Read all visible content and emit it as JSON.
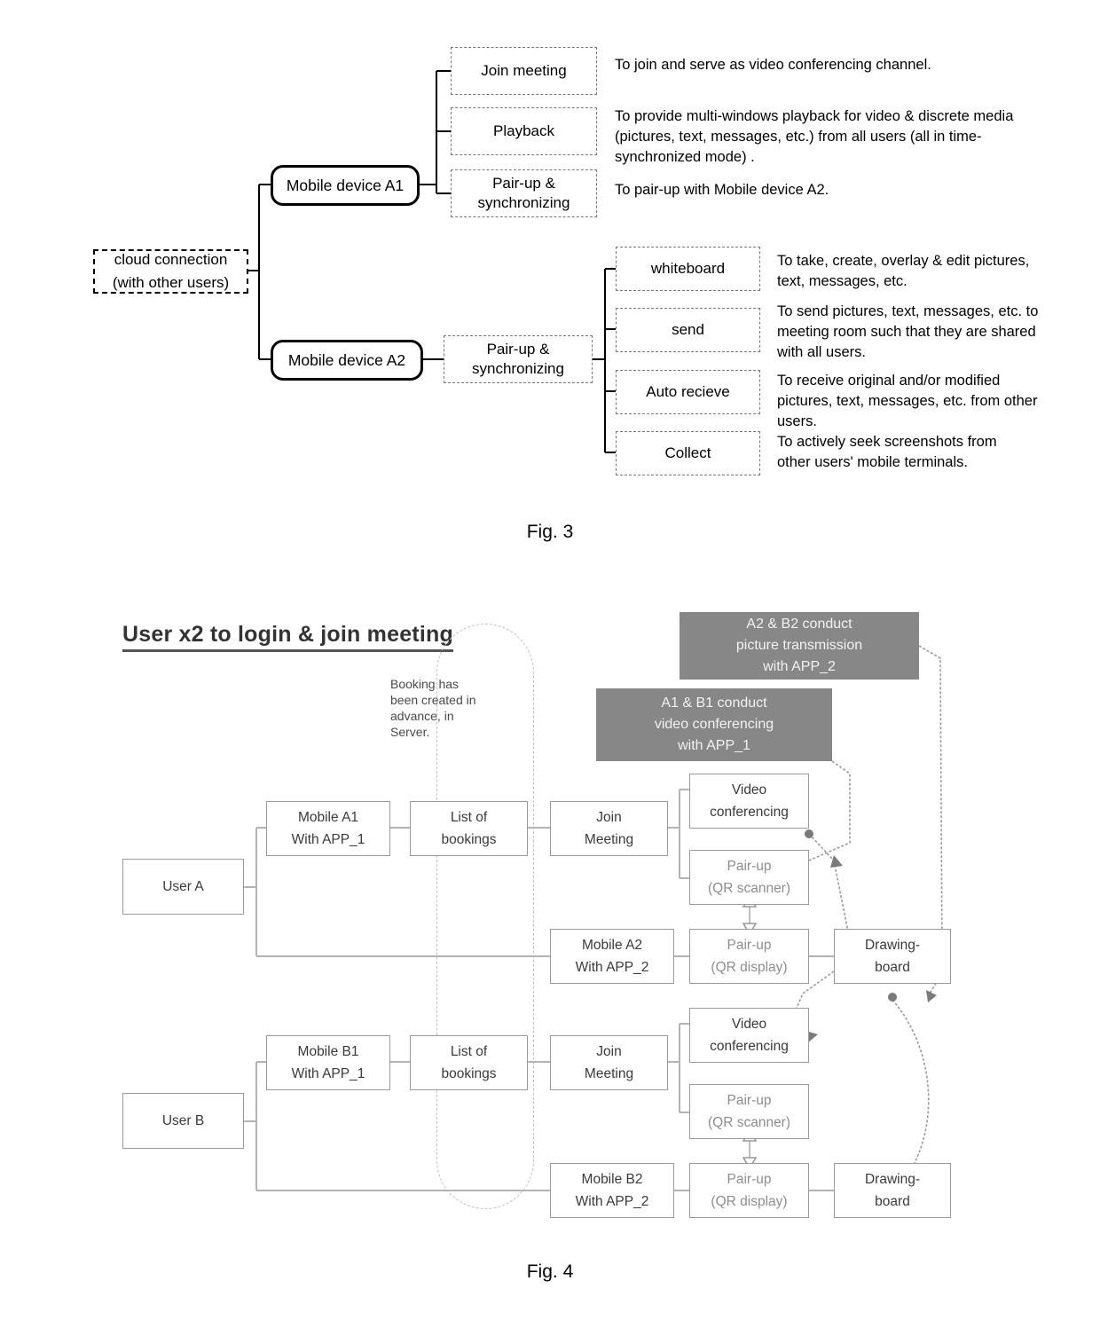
{
  "figure3": {
    "caption": "Fig. 3",
    "cloud": {
      "line1": "cloud connection",
      "line2": "(with other users)"
    },
    "devices": [
      {
        "label": "Mobile device A1"
      },
      {
        "label": "Mobile device A2"
      }
    ],
    "branch_a1": [
      {
        "label": "Join meeting",
        "description": "To join and serve as video conferencing channel."
      },
      {
        "label": "Playback",
        "description": "To provide multi-windows playback for video & discrete media (pictures, text, messages, etc.) from all users (all in time-synchronized mode) ."
      },
      {
        "label_line1": "Pair-up &",
        "label_line2": "synchronizing",
        "description": "To pair-up with Mobile device A2."
      }
    ],
    "branch_a2": {
      "node_line1": "Pair-up &",
      "node_line2": "synchronizing",
      "functions": [
        {
          "label": "whiteboard",
          "description": "To take, create, overlay & edit pictures, text, messages, etc."
        },
        {
          "label": "send",
          "description": "To send pictures, text, messages, etc. to meeting room such that they are shared with all users."
        },
        {
          "label": "Auto recieve",
          "description": "To receive original and/or modified pictures, text, messages, etc. from other users."
        },
        {
          "label": "Collect",
          "description": "To actively seek screenshots from other users' mobile terminals."
        }
      ]
    }
  },
  "figure4": {
    "caption": "Fig. 4",
    "title": "User x2 to login & join meeting",
    "note_booking": "Booking has been created in advance, in Server.",
    "callouts": [
      {
        "line1": "A2 & B2 conduct",
        "line2": "picture transmission",
        "line3": "with APP_2"
      },
      {
        "line1": "A1 & B1 conduct",
        "line2": "video conferencing",
        "line3": "with APP_1"
      }
    ],
    "rows": [
      {
        "user": "User A",
        "mobile1_line1": "Mobile A1",
        "mobile1_line2": "With APP_1",
        "bookings_line1": "List of",
        "bookings_line2": "bookings",
        "join_line1": "Join",
        "join_line2": "Meeting",
        "video_line1": "Video",
        "video_line2": "conferencing",
        "pair_scanner_line1": "Pair-up",
        "pair_scanner_line2": "(QR scanner)",
        "mobile2_line1": "Mobile A2",
        "mobile2_line2": "With APP_2",
        "pair_display_line1": "Pair-up",
        "pair_display_line2": "(QR display)",
        "board_line1": "Drawing-",
        "board_line2": "board"
      },
      {
        "user": "User B",
        "mobile1_line1": "Mobile B1",
        "mobile1_line2": "With APP_1",
        "bookings_line1": "List of",
        "bookings_line2": "bookings",
        "join_line1": "Join",
        "join_line2": "Meeting",
        "video_line1": "Video",
        "video_line2": "conferencing",
        "pair_scanner_line1": "Pair-up",
        "pair_scanner_line2": "(QR scanner)",
        "mobile2_line1": "Mobile B2",
        "mobile2_line2": "With APP_2",
        "pair_display_line1": "Pair-up",
        "pair_display_line2": "(QR display)",
        "board_line1": "Drawing-",
        "board_line2": "board"
      }
    ]
  },
  "colors": {
    "callout_bg": "#878787",
    "callout_text": "#f2f2f2",
    "box_border": "#9a9a9a",
    "box_text": "#555555",
    "fig3_line": "#000000"
  }
}
